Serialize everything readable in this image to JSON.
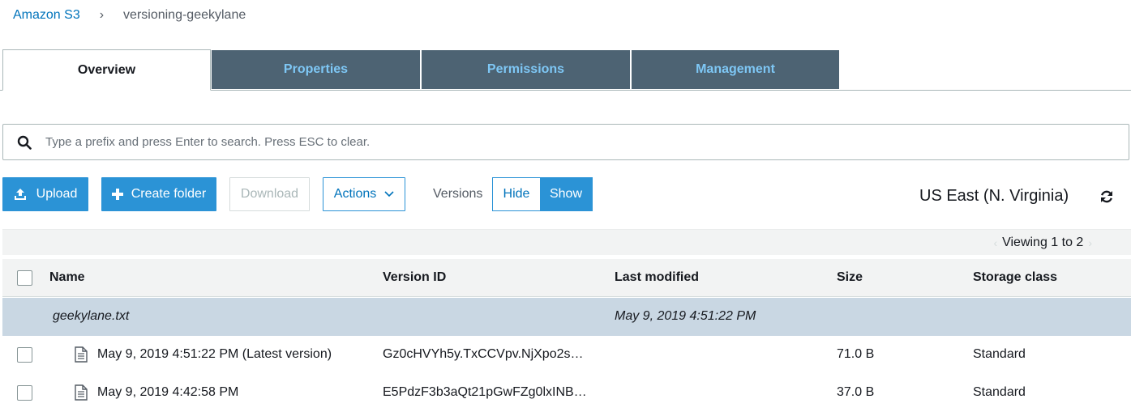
{
  "breadcrumb": {
    "root": "Amazon S3",
    "separator": "›",
    "current": "versioning-geekylane"
  },
  "tabs": [
    {
      "label": "Overview",
      "active": true
    },
    {
      "label": "Properties",
      "active": false
    },
    {
      "label": "Permissions",
      "active": false
    },
    {
      "label": "Management",
      "active": false
    }
  ],
  "search": {
    "placeholder": "Type a prefix and press Enter to search. Press ESC to clear.",
    "value": ""
  },
  "toolbar": {
    "upload_label": "Upload",
    "create_folder_label": "Create folder",
    "download_label": "Download",
    "actions_label": "Actions",
    "versions_label": "Versions",
    "hide_label": "Hide",
    "show_label": "Show",
    "versions_selected": "Show",
    "region": "US East (N. Virginia)"
  },
  "pagination": {
    "viewing": "Viewing 1 to 2"
  },
  "table": {
    "columns": [
      "Name",
      "Version ID",
      "Last modified",
      "Size",
      "Storage class"
    ],
    "group": {
      "name": "geekylane.txt",
      "last_modified": "May 9, 2019 4:51:22 PM"
    },
    "rows": [
      {
        "name": "May 9, 2019 4:51:22 PM (Latest version)",
        "version_id": "Gz0cHVYh5y.TxCCVpv.NjXpo2s…",
        "last_modified": "",
        "size": "71.0 B",
        "storage_class": "Standard"
      },
      {
        "name": "May 9, 2019 4:42:58 PM",
        "version_id": "E5PdzF3b3aQt21pGwFZg0lxINB…",
        "last_modified": "",
        "size": "37.0 B",
        "storage_class": "Standard"
      }
    ]
  },
  "colors": {
    "accent": "#2b93d6",
    "link": "#0073bb",
    "tab_inactive_bg": "#4d6373",
    "tab_inactive_text": "#7ec7f5",
    "group_row_bg": "#c9d7e3"
  },
  "icons": {
    "search": "search-icon",
    "upload": "upload-icon",
    "create_folder": "plus-icon",
    "actions": "chevron-down-icon",
    "refresh": "refresh-icon",
    "file": "file-icon"
  }
}
